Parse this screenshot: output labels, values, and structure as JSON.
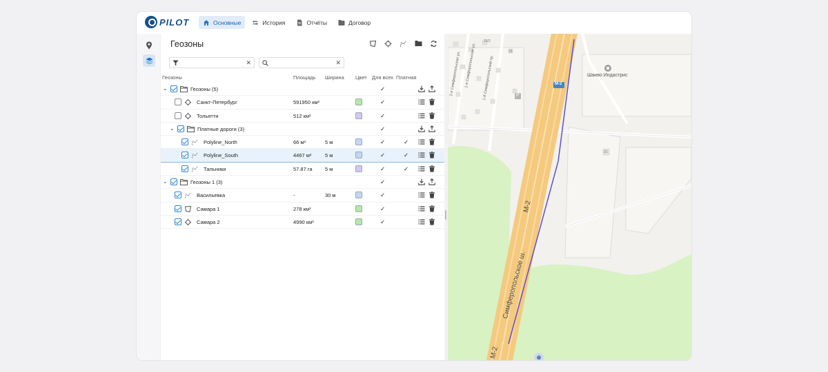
{
  "app": {
    "logo_text": "PILOT",
    "brand_color": "#14508a"
  },
  "nav": [
    {
      "label": "Основные",
      "icon": "home-icon",
      "active": true
    },
    {
      "label": "История",
      "icon": "history-icon",
      "active": false
    },
    {
      "label": "Отчёты",
      "icon": "report-icon",
      "active": false
    },
    {
      "label": "Договор",
      "icon": "contract-icon",
      "active": false
    }
  ],
  "panel": {
    "title": "Геозоны",
    "filter_placeholder": "",
    "search_placeholder": "",
    "columns": [
      "Геозоны",
      "Площадь",
      "Ширина",
      "Цвет",
      "Для всех",
      "Платная д"
    ]
  },
  "rows": [
    {
      "level": 0,
      "type": "group",
      "name": "Геозоны (5)",
      "area": "",
      "width": "",
      "color": "",
      "forall": "✓",
      "paid": "",
      "checked": true,
      "expanded": true
    },
    {
      "level": 1,
      "type": "point",
      "name": "Санкт-Петербург",
      "area": "591950 км²",
      "width": "",
      "color": "#b6e8a8",
      "forall": "✓",
      "paid": "",
      "checked": false
    },
    {
      "level": 1,
      "type": "point",
      "name": "Тольятти",
      "area": "512 км²",
      "width": "",
      "color": "#d6c6f4",
      "forall": "✓",
      "paid": "",
      "checked": false
    },
    {
      "level": 1,
      "type": "group",
      "name": "Платные дороги (3)",
      "area": "",
      "width": "",
      "color": "",
      "forall": "✓",
      "paid": "",
      "checked": true,
      "expanded": true
    },
    {
      "level": 2,
      "type": "line",
      "name": "Polyline_North",
      "area": "66 м²",
      "width": "5 м",
      "color": "#c4d6f4",
      "forall": "✓",
      "paid": "✓",
      "checked": true
    },
    {
      "level": 2,
      "type": "line",
      "name": "Polyline_South",
      "area": "4467 м²",
      "width": "5 м",
      "color": "#c4d6f4",
      "forall": "✓",
      "paid": "✓",
      "checked": true,
      "selected": true
    },
    {
      "level": 2,
      "type": "line",
      "name": "Тальники",
      "area": "57.87 га",
      "width": "5 м",
      "color": "#d6c6f4",
      "forall": "✓",
      "paid": "✓",
      "checked": true
    },
    {
      "level": 0,
      "type": "group",
      "name": "Геозоны 1 (3)",
      "area": "",
      "width": "",
      "color": "",
      "forall": "✓",
      "paid": "",
      "checked": true,
      "expanded": true
    },
    {
      "level": 1,
      "type": "line",
      "name": "Васильевка",
      "area": "-",
      "width": "30 м",
      "color": "#c4d6f4",
      "forall": "✓",
      "paid": "",
      "checked": true
    },
    {
      "level": 1,
      "type": "polygon",
      "name": "Самара 1",
      "area": "278 км²",
      "width": "",
      "color": "#b6e8a8",
      "forall": "✓",
      "paid": "",
      "checked": true
    },
    {
      "level": 1,
      "type": "point",
      "name": "Самара 2",
      "area": "4990 км²",
      "width": "",
      "color": "#b6e8a8",
      "forall": "✓",
      "paid": "",
      "checked": true
    }
  ],
  "map": {
    "labels": {
      "poi": "Шаиво Индастрис",
      "road_name": "Симферопольское ш.",
      "road_code_1": "М-2",
      "road_code_2": "М-2",
      "road_shield": "М-2",
      "street_1": "1-й Симферопольский пр.",
      "street_2": "1-я Симферопольская ул.",
      "street_3": "2-я Симферопольская ул.",
      "parking": "Р",
      "house_1": "25/2",
      "house_2": "15",
      "house_3": "21"
    },
    "colors": {
      "road": "#f5c97e",
      "forest": "#d8f2c3",
      "route": "#5a4fd4",
      "bg": "#f2f1ee"
    }
  }
}
